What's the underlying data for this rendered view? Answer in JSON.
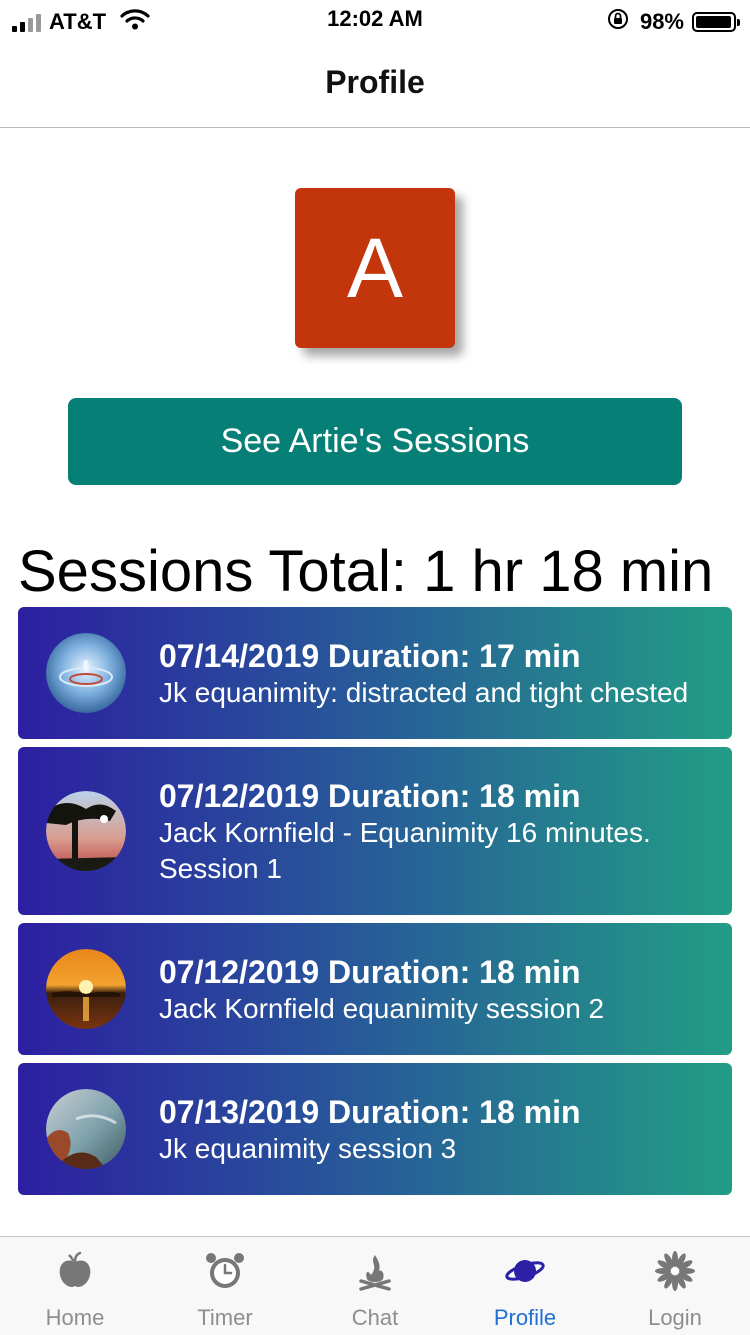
{
  "status_bar": {
    "carrier": "AT&T",
    "time": "12:02 AM",
    "battery_percent": "98%",
    "battery_level": 0.98
  },
  "nav": {
    "title": "Profile"
  },
  "profile": {
    "avatar_letter": "A",
    "avatar_color": "#c3360c",
    "sessions_button": "See Artie's Sessions",
    "sessions_total": "Sessions Total: 1 hr 18 min"
  },
  "sessions": [
    {
      "title": "07/14/2019 Duration: 17 min",
      "description": "Jk equanimity: distracted and tight chested",
      "thumbnail": "water-drop-image"
    },
    {
      "title": "07/12/2019 Duration: 18 min",
      "description": "Jack Kornfield - Equanimity 16 minutes. Session 1",
      "thumbnail": "tree-silhouette-image"
    },
    {
      "title": "07/12/2019 Duration: 18 min",
      "description": "Jack Kornfield equanimity session 2",
      "thumbnail": "sunset-image"
    },
    {
      "title": "07/13/2019 Duration: 18 min",
      "description": "Jk equanimity session 3",
      "thumbnail": "rocky-coast-image"
    }
  ],
  "tabs": [
    {
      "label": "Home",
      "icon": "fruit-icon",
      "active": false
    },
    {
      "label": "Timer",
      "icon": "alarm-clock-icon",
      "active": false
    },
    {
      "label": "Chat",
      "icon": "campfire-icon",
      "active": false
    },
    {
      "label": "Profile",
      "icon": "planet-icon",
      "active": true
    },
    {
      "label": "Login",
      "icon": "flower-icon",
      "active": false
    }
  ],
  "colors": {
    "accent_button": "#068077",
    "card_gradient_start": "#2c1fa1",
    "card_gradient_end": "#229d85",
    "active_tab": "#1f6fd6",
    "inactive_tab": "#8e8e8e"
  }
}
